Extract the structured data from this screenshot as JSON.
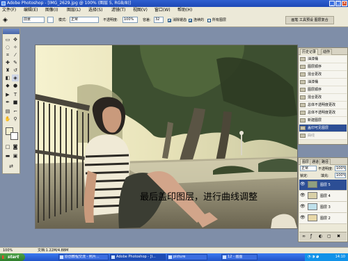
{
  "window": {
    "title": "Adobe Photoshop - [IMG_2629.jpg @ 100% (图层 5, RGB/8)]"
  },
  "menubar": {
    "items": [
      "文件(F)",
      "编辑(E)",
      "图像(I)",
      "图层(L)",
      "选择(S)",
      "滤镜(T)",
      "视图(V)",
      "窗口(W)",
      "帮助(H)"
    ]
  },
  "options": {
    "preset_value": "前景",
    "mode_label": "模式:",
    "mode_value": "正常",
    "opacity_label": "不透明度:",
    "opacity_value": "100%",
    "tolerance_label": "容差:",
    "tolerance_value": "32",
    "antialias_label": "消除锯齿",
    "contiguous_label": "连续的",
    "alllayers_label": "所有图层",
    "brush_tab": "画笔  工具预设  图层复合"
  },
  "canvas": {
    "caption": "最后盖印图层，进行曲线调整"
  },
  "history": {
    "tabs": [
      "历史记录",
      "动作"
    ],
    "items": [
      {
        "label": "油漆桶",
        "state": "normal"
      },
      {
        "label": "图层顺序",
        "state": "normal"
      },
      {
        "label": "混合更改",
        "state": "normal"
      },
      {
        "label": "油漆桶",
        "state": "normal"
      },
      {
        "label": "图层顺序",
        "state": "normal"
      },
      {
        "label": "混合更改",
        "state": "normal"
      },
      {
        "label": "总体不透明度更改",
        "state": "normal"
      },
      {
        "label": "总体不透明度更改",
        "state": "normal"
      },
      {
        "label": "新建图层",
        "state": "normal"
      },
      {
        "label": "盖印可见图层",
        "state": "selected"
      },
      {
        "label": "曲线",
        "state": "dim"
      }
    ]
  },
  "layers": {
    "tabs": [
      "图层",
      "通道",
      "路径"
    ],
    "blend_mode": "正常",
    "opacity_label": "不透明度:",
    "opacity_value": "100%",
    "lock_label": "锁定:",
    "fill_label": "填充:",
    "fill_value": "100%",
    "items": [
      {
        "name": "图层 5",
        "selected": true,
        "thumb_color": "#8fa07f"
      },
      {
        "name": "图层 4",
        "selected": false,
        "thumb_color": "#d9d0a8"
      },
      {
        "name": "图层 3",
        "selected": false,
        "thumb_color": "#bfe0ea"
      },
      {
        "name": "图层 2",
        "selected": false,
        "thumb_color": "#e8d8a8"
      }
    ]
  },
  "status": {
    "zoom": "100%",
    "doc_info": "文档:1.22M/4.88M"
  },
  "taskbar": {
    "start_label": "start",
    "tasks": [
      {
        "label": "原创教程交流 - 照片...",
        "active": false
      },
      {
        "label": "Adobe Photoshop - [I...",
        "active": true
      },
      {
        "label": "picture",
        "active": false
      },
      {
        "label": "12 - 画图",
        "active": false
      }
    ],
    "clock": "14:10"
  },
  "colors": {
    "titlebar": "#1d49b6",
    "selection": "#2c4e95",
    "chrome": "#ece9d8"
  }
}
